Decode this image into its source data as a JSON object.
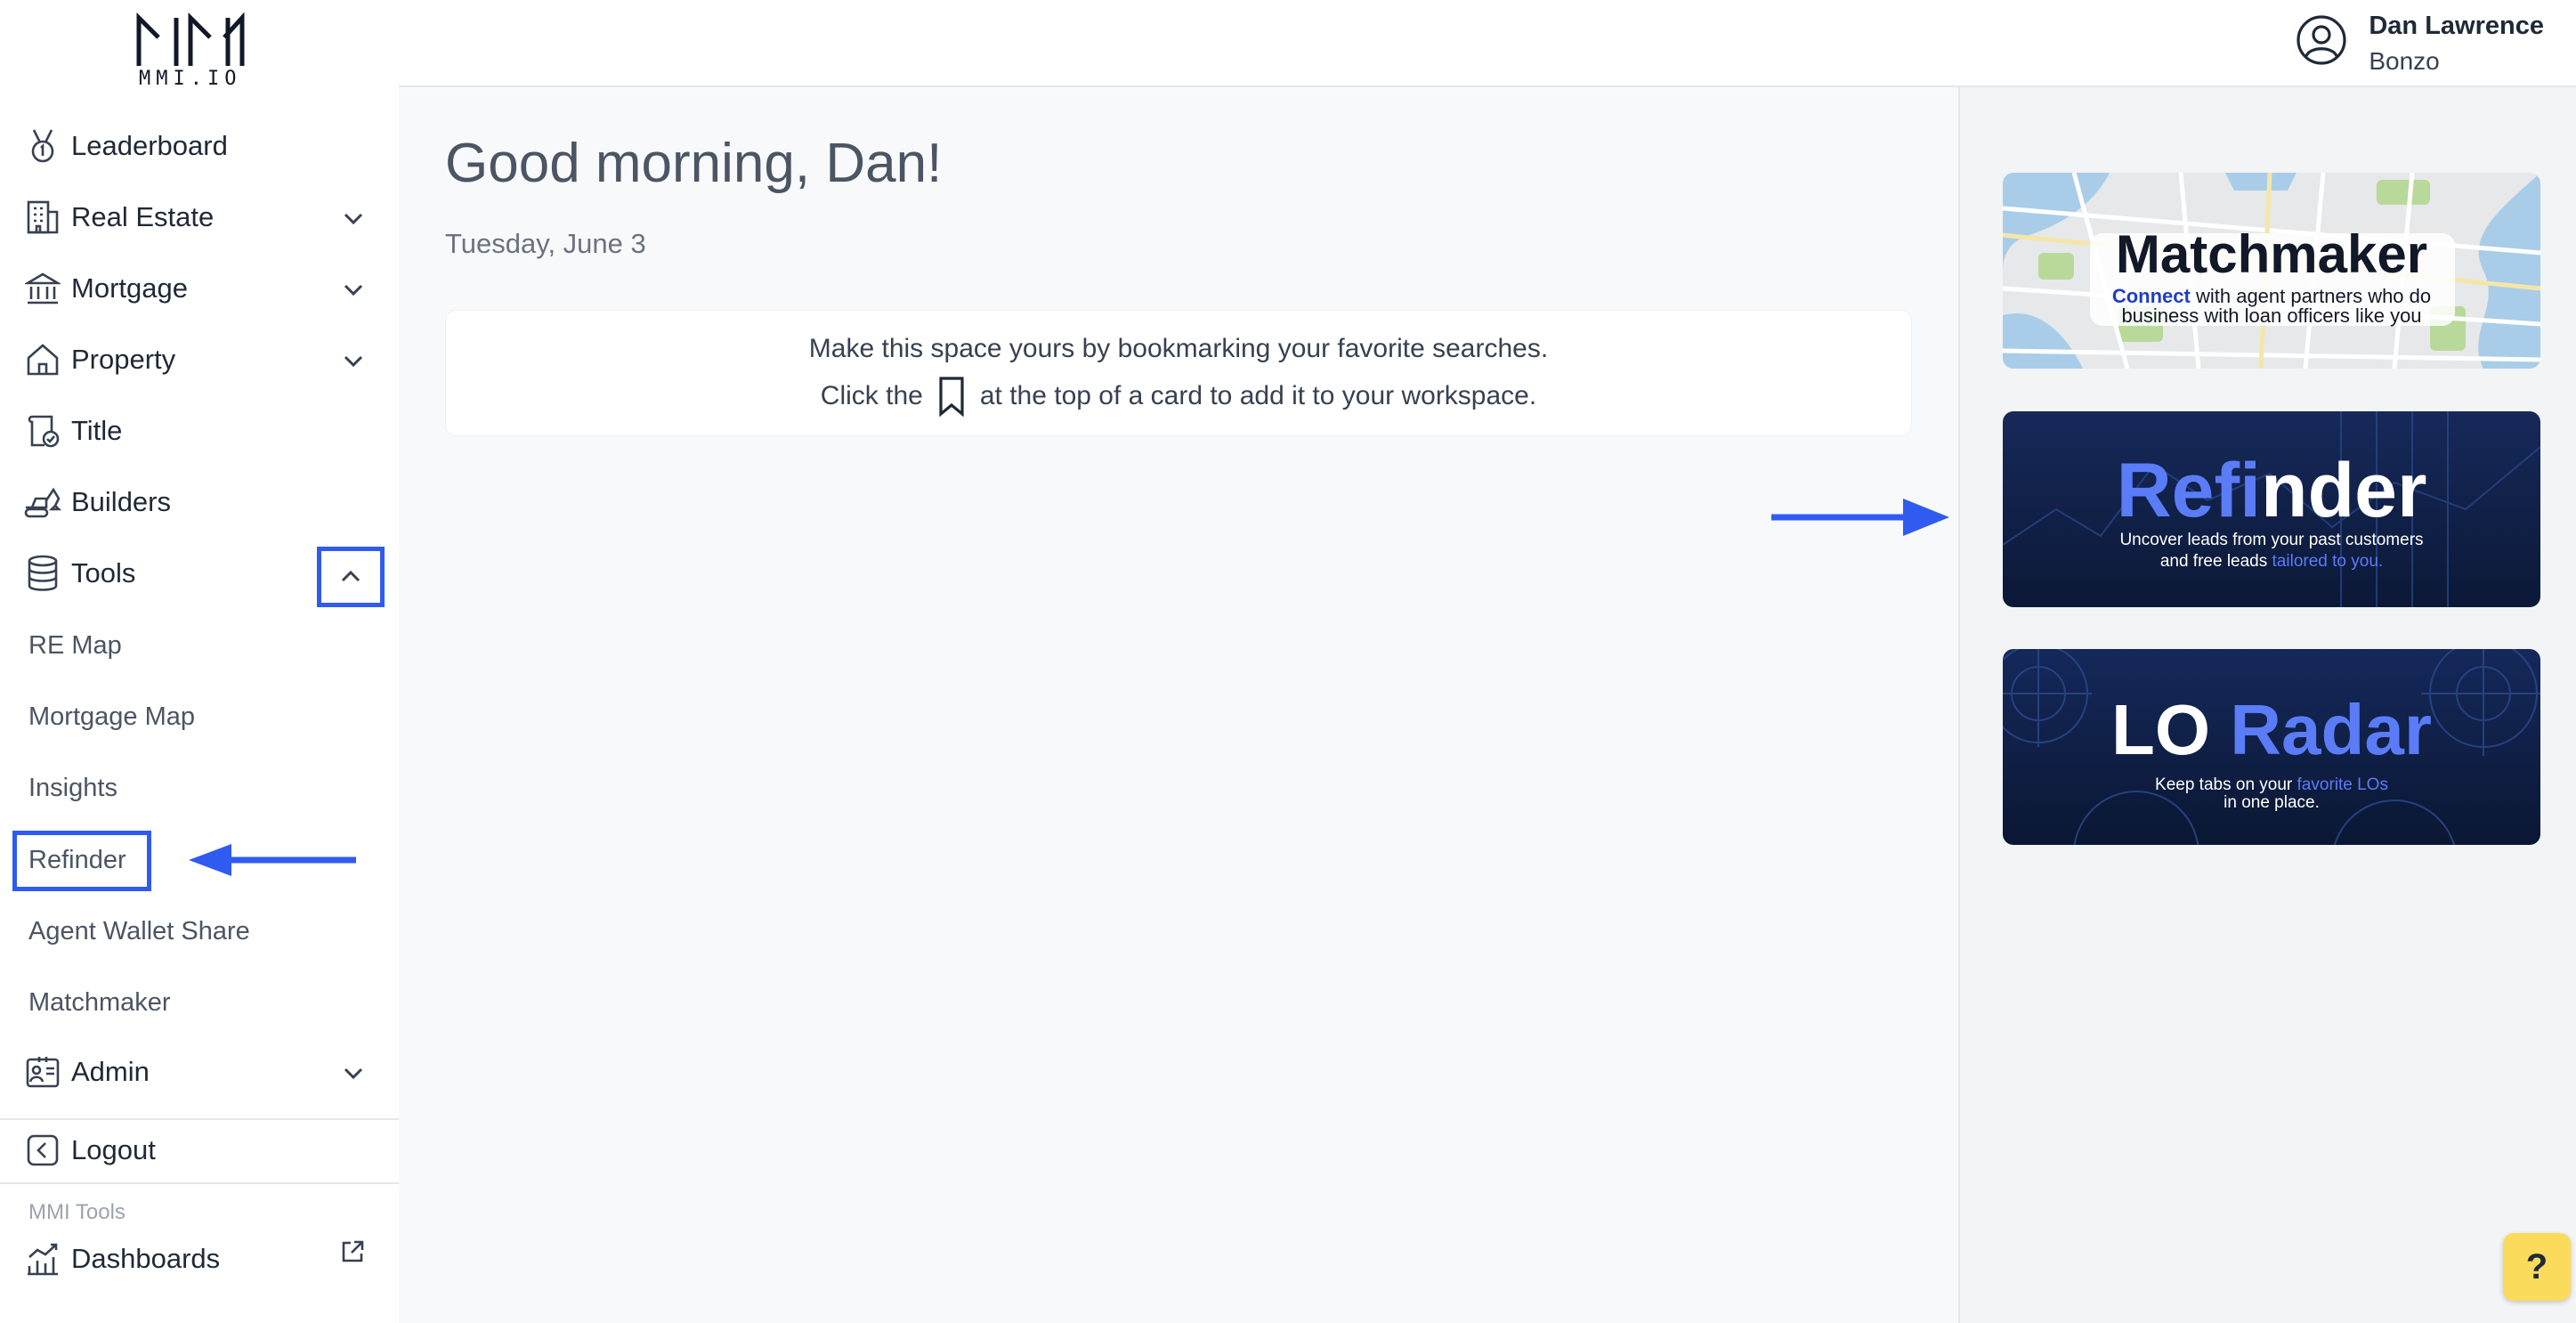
{
  "user": {
    "name": "Dan Lawrence",
    "company": "Bonzo"
  },
  "logo": {
    "text": "MMI.IO"
  },
  "sidebar": {
    "items": [
      {
        "label": "Leaderboard"
      },
      {
        "label": "Real Estate"
      },
      {
        "label": "Mortgage"
      },
      {
        "label": "Property"
      },
      {
        "label": "Title"
      },
      {
        "label": "Builders"
      },
      {
        "label": "Tools"
      },
      {
        "label": "Admin"
      },
      {
        "label": "Logout"
      }
    ],
    "tools_sub": [
      "RE Map",
      "Mortgage Map",
      "Insights",
      "Refinder",
      "Agent Wallet Share",
      "Matchmaker"
    ],
    "section_label": "MMI Tools",
    "dashboards_label": "Dashboards"
  },
  "main": {
    "greeting": "Good morning, Dan!",
    "date": "Tuesday, June 3",
    "info_line1": "Make this space yours by bookmarking your favorite searches.",
    "info_click": "Click the",
    "info_rest": "at the top of a card to add it to your workspace."
  },
  "promos": {
    "matchmaker": {
      "title": "Matchmaker",
      "connect": "Connect",
      "line1_rest": "with agent partners who do",
      "line2": "business with loan officers like you"
    },
    "refinder": {
      "title_a": "Refi",
      "title_b": "nder",
      "line1": "Uncover leads from your past customers",
      "line2_a": "and free leads",
      "line2_b": "tailored to you."
    },
    "loradar": {
      "title_a": "LO",
      "title_b": "Radar",
      "line1_a": "Keep tabs on your",
      "line1_b": "favorite LOs",
      "line2": "in one place."
    }
  },
  "help": {
    "label": "?"
  },
  "colors": {
    "accent": "#2f5bf0",
    "promo_bg": "#0f1f44",
    "promo_highlight": "#5b7cf7",
    "help_bg": "#fbdb5b"
  }
}
